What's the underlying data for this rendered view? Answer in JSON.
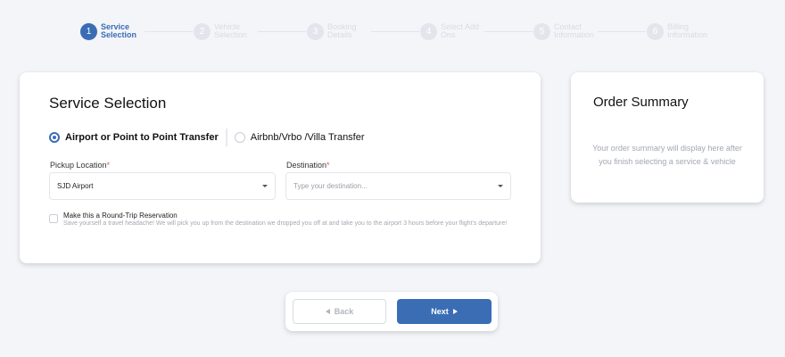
{
  "stepper": {
    "steps": [
      {
        "number": "1",
        "label": "Service Selection",
        "state": "active"
      },
      {
        "number": "2",
        "label": "Vehicle Selection",
        "state": "inactive"
      },
      {
        "number": "3",
        "label": "Booking Details",
        "state": "inactive"
      },
      {
        "number": "4",
        "label": "Select Add Ons",
        "state": "inactive"
      },
      {
        "number": "5",
        "label": "Contact Information",
        "state": "inactive"
      },
      {
        "number": "6",
        "label": "Billing Information",
        "state": "inactive"
      }
    ]
  },
  "service": {
    "title": "Service Selection",
    "options": [
      {
        "label": "Airport or Point to Point Transfer",
        "selected": true
      },
      {
        "label": "Airbnb/Vrbo /Villa Transfer",
        "selected": false
      }
    ],
    "pickup": {
      "label": "Pickup Location",
      "required_mark": "*",
      "value": "SJD Airport"
    },
    "destination": {
      "label": "Destination",
      "required_mark": "*",
      "placeholder": "Type your destination..."
    },
    "round_trip": {
      "title": "Make this a Round-Trip Reservation",
      "description": "Save yourself a travel headache! We will pick you up from the destination we dropped you off at and take you to the airport 3 hours before your flight's departure!",
      "checked": false
    }
  },
  "summary": {
    "title": "Order Summary",
    "text": "Your order summary will display here after you finish selecting a service & vehicle"
  },
  "nav": {
    "back_label": "Back",
    "next_label": "Next"
  },
  "colors": {
    "accent": "#3a6db4",
    "required": "#e15a5a",
    "background": "#f3f5f9"
  }
}
